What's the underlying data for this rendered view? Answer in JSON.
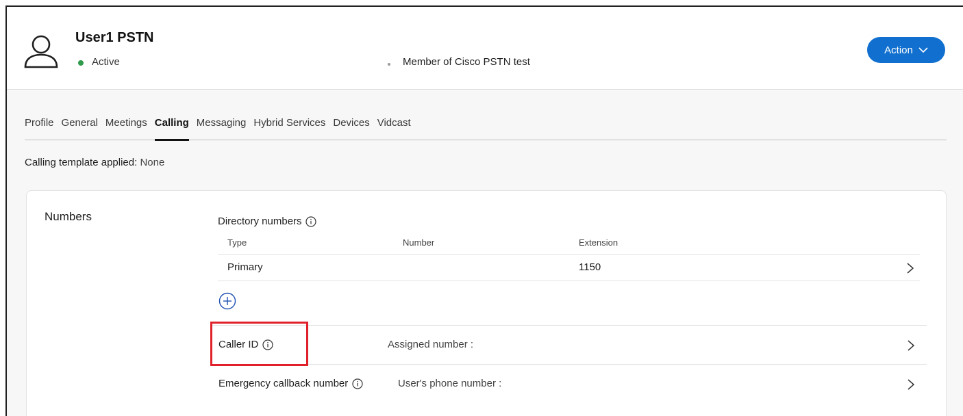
{
  "user": {
    "name": "User1 PSTN",
    "status": "Active",
    "status_color": "#2e9a4a",
    "membership": "Member of Cisco PSTN test"
  },
  "header": {
    "action_label": "Action",
    "action_color": "#1170cf"
  },
  "tabs": [
    {
      "label": "Profile",
      "active": false
    },
    {
      "label": "General",
      "active": false
    },
    {
      "label": "Meetings",
      "active": false
    },
    {
      "label": "Calling",
      "active": true
    },
    {
      "label": "Messaging",
      "active": false
    },
    {
      "label": "Hybrid Services",
      "active": false
    },
    {
      "label": "Devices",
      "active": false
    },
    {
      "label": "Vidcast",
      "active": false
    }
  ],
  "template": {
    "label": "Calling template applied:",
    "value": "None"
  },
  "numbers": {
    "title": "Numbers",
    "directory_label": "Directory numbers",
    "columns": {
      "type": "Type",
      "number": "Number",
      "extension": "Extension"
    },
    "rows": [
      {
        "type": "Primary",
        "number": "",
        "extension": "1150"
      }
    ],
    "caller_id": {
      "label": "Caller ID",
      "value": "Assigned number :"
    },
    "emergency": {
      "label": "Emergency callback number",
      "value": "User's phone number :"
    }
  },
  "highlight_color": "#e0202a",
  "icons": [
    "user-avatar-icon",
    "chevron-down-icon",
    "info-icon",
    "chevron-right-icon",
    "add-circle-icon"
  ]
}
